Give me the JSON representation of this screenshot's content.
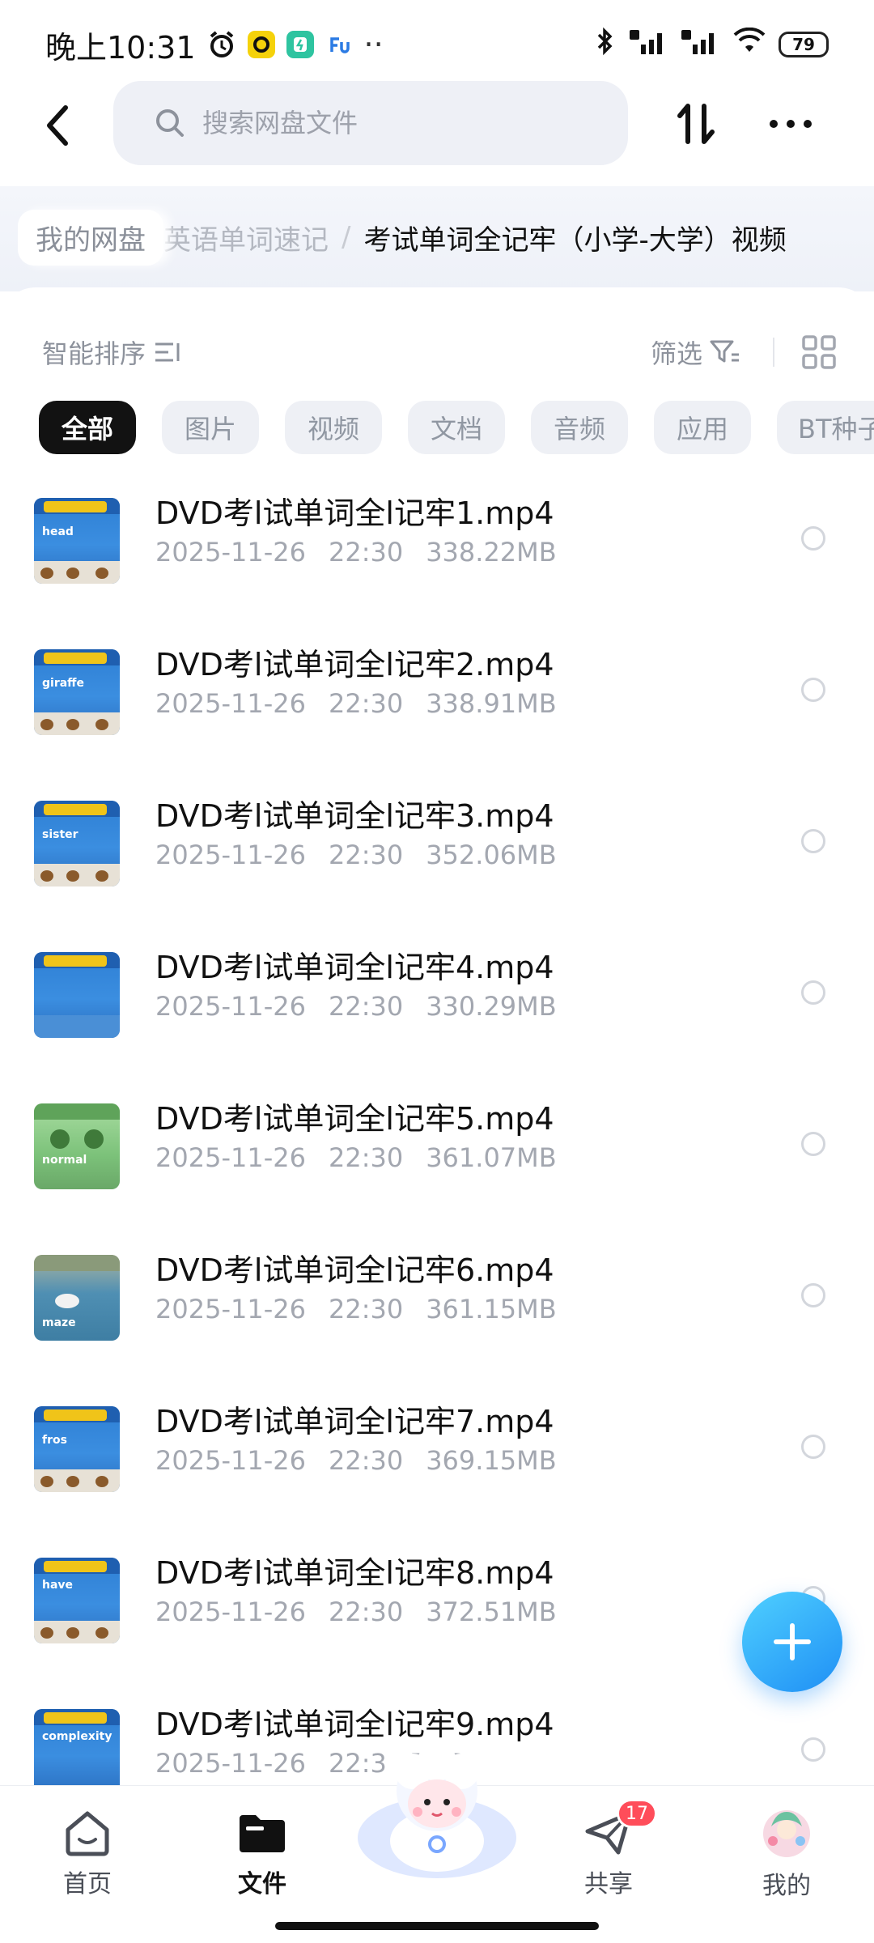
{
  "status_bar": {
    "time": "晚上10:31",
    "battery": "79",
    "more": "··"
  },
  "header": {
    "search_placeholder": "搜索网盘文件"
  },
  "breadcrumb": {
    "root": "我的网盘",
    "parent": "英语单词速记",
    "separator": "/",
    "current": "考试单词全记牢（小学-大学）视频"
  },
  "toolbar": {
    "sort_label": "智能排序",
    "filter_label": "筛选"
  },
  "chips": [
    "全部",
    "图片",
    "视频",
    "文档",
    "音频",
    "应用",
    "BT种子"
  ],
  "files": [
    {
      "name": "DVD考l试单词全l记牢1.mp4",
      "date": "2025-11-26",
      "time": "22:30",
      "size": "338.22MB",
      "thumb_word": "head"
    },
    {
      "name": "DVD考l试单词全l记牢2.mp4",
      "date": "2025-11-26",
      "time": "22:30",
      "size": "338.91MB",
      "thumb_word": "giraffe"
    },
    {
      "name": "DVD考l试单词全l记牢3.mp4",
      "date": "2025-11-26",
      "time": "22:30",
      "size": "352.06MB",
      "thumb_word": "sister"
    },
    {
      "name": "DVD考l试单词全l记牢4.mp4",
      "date": "2025-11-26",
      "time": "22:30",
      "size": "330.29MB",
      "thumb_word": ""
    },
    {
      "name": "DVD考l试单词全l记牢5.mp4",
      "date": "2025-11-26",
      "time": "22:30",
      "size": "361.07MB",
      "thumb_word": "normal"
    },
    {
      "name": "DVD考l试单词全l记牢6.mp4",
      "date": "2025-11-26",
      "time": "22:30",
      "size": "361.15MB",
      "thumb_word": "maze"
    },
    {
      "name": "DVD考l试单词全l记牢7.mp4",
      "date": "2025-11-26",
      "time": "22:30",
      "size": "369.15MB",
      "thumb_word": "fros"
    },
    {
      "name": "DVD考l试单词全l记牢8.mp4",
      "date": "2025-11-26",
      "time": "22:30",
      "size": "372.51MB",
      "thumb_word": "have"
    },
    {
      "name": "DVD考l试单词全l记牢9.mp4",
      "date": "2025-11-26",
      "time": "22:3",
      "size": "5MB",
      "thumb_word": "complexity"
    }
  ],
  "bottom_nav": {
    "home": "首页",
    "files": "文件",
    "share": "共享",
    "share_badge": "17",
    "me": "我的"
  },
  "colors": {
    "accent": "#1f8ff5",
    "chip_active_bg": "#121212",
    "badge": "#ff4d5a"
  }
}
